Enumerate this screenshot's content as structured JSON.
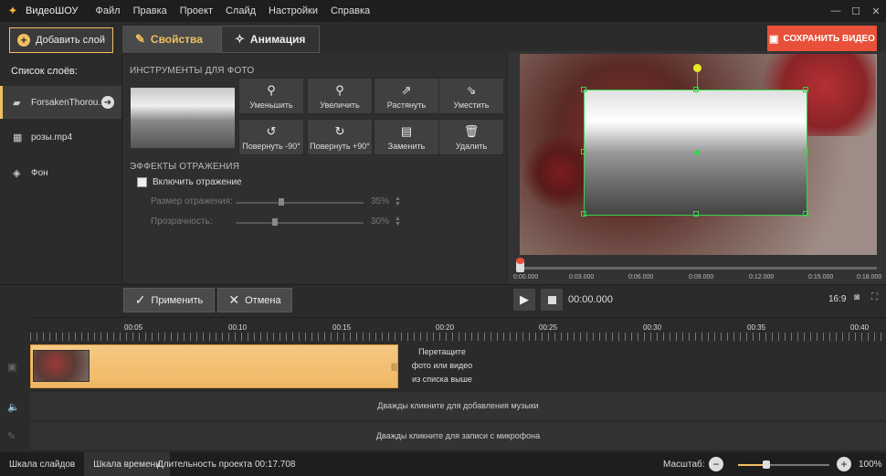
{
  "menubar": {
    "app_name": "ВидеоШОУ",
    "items": [
      "Файл",
      "Правка",
      "Проект",
      "Слайд",
      "Настройки",
      "Справка"
    ]
  },
  "toolbar": {
    "add_layer": "Добавить слой",
    "tab_properties": "Свойства",
    "tab_animation": "Анимация",
    "save_video": "СОХРАНИТЬ ВИДЕО"
  },
  "layers": {
    "title": "Список слоёв:",
    "items": [
      {
        "label": "ForsakenThorou...",
        "icon": "image-icon"
      },
      {
        "label": "розы.mp4",
        "icon": "film-icon"
      },
      {
        "label": "Фон",
        "icon": "bucket-icon"
      }
    ]
  },
  "photo_tools": {
    "title": "ИНСТРУМЕНТЫ ДЛЯ ФОТО",
    "buttons": [
      {
        "label": "Уменьшить",
        "icon": "zoom-out-icon"
      },
      {
        "label": "Увеличить",
        "icon": "zoom-in-icon"
      },
      {
        "label": "Растянуть",
        "icon": "stretch-icon"
      },
      {
        "label": "Уместить",
        "icon": "fit-icon"
      },
      {
        "label": "Повернуть -90°",
        "icon": "rotate-left-icon"
      },
      {
        "label": "Повернуть +90°",
        "icon": "rotate-right-icon"
      },
      {
        "label": "Заменить",
        "icon": "replace-icon"
      },
      {
        "label": "Удалить",
        "icon": "trash-icon"
      }
    ]
  },
  "reflection": {
    "title": "ЭФФЕКТЫ ОТРАЖЕНИЯ",
    "enable_label": "Включить отражение",
    "size_label": "Размер отражения:",
    "size_value": "35%",
    "size_level": 35,
    "opacity_label": "Прозрачность:",
    "opacity_value": "30%",
    "opacity_level": 30
  },
  "preview": {
    "ticks": [
      "0:00.000",
      "0:03.000",
      "0:06.000",
      "0:09.000",
      "0:12.000",
      "0:15.000",
      "0:18.000"
    ],
    "marker": "1"
  },
  "controls": {
    "apply": "Применить",
    "cancel": "Отмена",
    "timecode": "00:00.000",
    "ratio": "16:9"
  },
  "timeline": {
    "ticks": [
      "00:05",
      "00:10",
      "00:15",
      "00:20",
      "00:25",
      "00:30",
      "00:35",
      "00:40"
    ],
    "drag_hint_1": "Перетащите",
    "drag_hint_2": "фото или видео",
    "drag_hint_3": "из списка выше",
    "music_hint": "Дважды кликните для добавления музыки",
    "mic_hint": "Дважды кликните для записи с микрофона"
  },
  "statusbar": {
    "tab_slides": "Шкала слайдов",
    "tab_timeline": "Шкала времени",
    "duration": "Длительность проекта 00:17.708",
    "zoom_label": "Масштаб:",
    "zoom_value": "100%"
  },
  "colors": {
    "accent": "#f0c060",
    "save": "#e8503a",
    "selection": "#3bd14a"
  }
}
